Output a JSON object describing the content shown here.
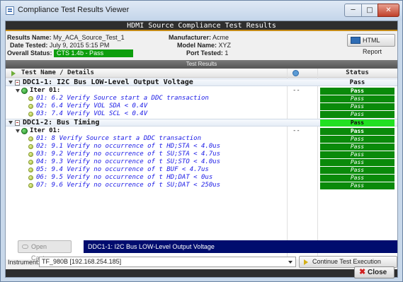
{
  "window": {
    "title": "Compliance Test Results Viewer",
    "min_glyph": "─",
    "max_glyph": "□",
    "close_glyph": "✕"
  },
  "banner": "HDMI Source Compliance Test Results",
  "info": {
    "results_name_label": "Results Name:",
    "results_name": "My_ACA_Source_Test_1",
    "date_label": "Date Tested:",
    "date": "July 9, 2015 5:15 PM",
    "overall_label": "Overall Status:",
    "overall": "CTS 1.4b - Pass",
    "manufacturer_label": "Manufacturer:",
    "manufacturer": "Acme",
    "model_label": "Model Name:",
    "model": "XYZ",
    "port_label": "Port Tested:",
    "port": "1"
  },
  "html_report_label": "HTML Report",
  "results_header": "Test Results",
  "columns": {
    "name": "Test Name / Details",
    "status": "Status"
  },
  "groups": [
    {
      "title": "DDC1-1: I2C Bus LOW-Level Output Voltage",
      "status": "Pass",
      "iter": {
        "label": "Iter 01:",
        "time": "--",
        "status": "Pass"
      },
      "steps": [
        {
          "label": "01: 6.2  Verify Source start a DDC transaction",
          "status": "Pass"
        },
        {
          "label": "02: 6.4  Verify VOL SDA < 0.4V",
          "status": "Pass"
        },
        {
          "label": "03: 7.4  Verify VOL SCL < 0.4V",
          "status": "Pass"
        }
      ]
    },
    {
      "title": "DDC1-2: Bus Timing",
      "status": "Pass",
      "iter": {
        "label": "Iter 01:",
        "time": "--",
        "status": "Pass"
      },
      "steps": [
        {
          "label": "01: 8    Verify Source start a DDC transaction",
          "status": "Pass"
        },
        {
          "label": "02: 9.1  Verify no occurrence of t HD;STA < 4.0us",
          "status": "Pass"
        },
        {
          "label": "03: 9.2  Verify no occurrence of t SU;STA < 4.7us",
          "status": "Pass"
        },
        {
          "label": "04: 9.3  Verify no occurrence of t SU;STO < 4.0us",
          "status": "Pass"
        },
        {
          "label": "05: 9.4  Verify no occurrence of t BUF < 4.7us",
          "status": "Pass"
        },
        {
          "label": "06: 9.5  Verify no occurrence of t HD;DAT < 0us",
          "status": "Pass"
        },
        {
          "label": "07: 9.6  Verify no occurrence of t SU;DAT < 250us",
          "status": "Pass"
        }
      ]
    }
  ],
  "open_capture_label": "Open Capture",
  "selected_test": "DDC1-1: I2C Bus LOW-Level Output Voltage",
  "instrument_label": "Instrument:",
  "instrument_value": "TF_980B [192.168.254.185]",
  "continue_label": "Continue Test Execution",
  "close_label": "Close",
  "close_glyph": "✖"
}
